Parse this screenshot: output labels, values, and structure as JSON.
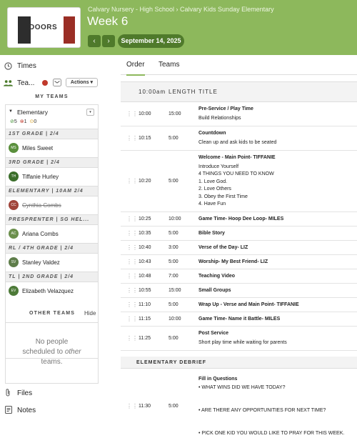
{
  "header": {
    "breadcrumb": "Calvary Nursery - High School › Calvary Kids Sunday Elementary",
    "title": "Week 6",
    "date": "September 14, 2025",
    "prev_label": "‹",
    "next_label": "›",
    "thumb_text": "DOORS"
  },
  "sidebar": {
    "times_label": "Times",
    "teams_label": "Tea...",
    "actions_label": "Actions ▾",
    "my_teams_label": "MY TEAMS",
    "team_name": "Elementary",
    "counts": {
      "confirmed": "5",
      "declined": "1",
      "pending": "0"
    },
    "groups": [
      {
        "label": "1ST GRADE | 2/4",
        "person": "Miles Sweet",
        "initials": "MS",
        "color": "#5a8f3c",
        "struck": false
      },
      {
        "label": "3RD GRADE | 2/4",
        "person": "Tiffanie Hurley",
        "initials": "TH",
        "color": "#3b6e2a",
        "struck": false
      },
      {
        "label": "ELEMENTARY | 10AM 2/4",
        "person": "Cynthia Combs",
        "initials": "CC",
        "color": "#a0443a",
        "struck": true
      },
      {
        "label": "PRESPRENTER | SG HEL...",
        "person": "Ariana Combs",
        "initials": "AC",
        "color": "#6b8f4c",
        "struck": false
      },
      {
        "label": "RL / 4TH GRADE | 2/4",
        "person": "Stanley Valdez",
        "initials": "SV",
        "color": "#5e7d4a",
        "struck": false
      },
      {
        "label": "TL | 2ND GRADE | 2/4",
        "person": "Elizabeth Velazquez",
        "initials": "EV",
        "color": "#4d7a38",
        "struck": false
      }
    ],
    "other_teams_label": "OTHER TEAMS",
    "hide_label": "Hide",
    "no_people_line1": "No people",
    "no_people_line2": "scheduled to ",
    "no_people_other": "other",
    "no_people_line3": "teams.",
    "files_label": "Files",
    "notes_label": "Notes"
  },
  "main": {
    "tab_order": "Order",
    "tab_teams": "Teams",
    "col_time": "10:00am",
    "col_length": "LENGTH",
    "col_title": "TITLE",
    "items": [
      {
        "time": "10:00",
        "length": "15:00",
        "title": "Pre-Service / Play Time",
        "desc": [
          "Build Relationships"
        ]
      },
      {
        "time": "10:15",
        "length": "5:00",
        "title": "Countdown",
        "desc": [
          "Clean up and ask kids to be seated"
        ]
      },
      {
        "time": "10:20",
        "length": "5:00",
        "title": "Welcome - Main Point- TIFFANIE",
        "desc": [
          "Introduce Yourself",
          "4 THINGS YOU NEED TO KNOW",
          "1. Love God.",
          "2. Love Others",
          "3. Obey the First Time",
          "4. Have Fun"
        ]
      },
      {
        "time": "10:25",
        "length": "10:00",
        "title": "Game Time- Hoop Dee Loop- MILES",
        "desc": []
      },
      {
        "time": "10:35",
        "length": "5:00",
        "title": "Bible Story",
        "desc": []
      },
      {
        "time": "10:40",
        "length": "3:00",
        "title": "Verse of the Day- LIZ",
        "desc": []
      },
      {
        "time": "10:43",
        "length": "5:00",
        "title": "Worship- My Best Friend- LIZ",
        "desc": []
      },
      {
        "time": "10:48",
        "length": "7:00",
        "title": "Teaching Video",
        "desc": []
      },
      {
        "time": "10:55",
        "length": "15:00",
        "title": "Small Groups",
        "desc": []
      },
      {
        "time": "11:10",
        "length": "5:00",
        "title": "Wrap Up - Verse and Main Point- TIFFANIE",
        "desc": []
      },
      {
        "time": "11:15",
        "length": "10:00",
        "title": "Game Time- Name it Battle- MILES",
        "desc": []
      },
      {
        "time": "11:25",
        "length": "5:00",
        "title": "Post Service",
        "desc": [
          "Short play time while waiting for parents"
        ]
      }
    ],
    "section_label": "ELEMENTARY DEBRIEF",
    "debrief": {
      "time": "11:30",
      "length": "5:00",
      "title": "Fill in Questions",
      "lines": [
        "• WHAT WINS DID WE HAVE TODAY?",
        "• ARE THERE ANY OPPORTUNITIES FOR NEXT TIME?",
        "• PICK ONE KID YOU WOULD LIKE TO PRAY FOR THIS WEEK."
      ]
    }
  }
}
